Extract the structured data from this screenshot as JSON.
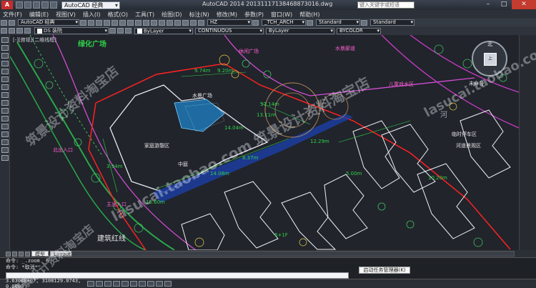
{
  "titlebar": {
    "workspace": "AutoCAD 经典",
    "title": "AutoCAD 2014    20131117138468873016.dwg",
    "search_placeholder": "键入关键字或短语"
  },
  "menus": [
    "文件(F)",
    "编辑(E)",
    "视图(V)",
    "插入(I)",
    "格式(O)",
    "工具(T)",
    "绘图(D)",
    "标注(N)",
    "修改(M)",
    "参数(P)",
    "窗口(W)",
    "帮助(H)"
  ],
  "toolbar1": {
    "workspace_dropdown": "AutoCAD 经典",
    "style1": "HZ",
    "style2": "_TCH_ARCH",
    "style3": "Standard",
    "style4": "Standard"
  },
  "toolbar2": {
    "layer": "DS 装院",
    "color": "ByLayer",
    "linetype": "CONTINUOUS",
    "lineweight": "ByLayer",
    "plotstyle": "BYCOLOR"
  },
  "viewport": {
    "label": "[-][俯视][二维线框]",
    "viewcube_face": "上",
    "viewcube_north": "北",
    "ucs_label": "未命名"
  },
  "drawing_labels": [
    "绿化广场",
    "休闲广场",
    "儿童戏水区",
    "家庭游憩区",
    "水景广场",
    "北出入口",
    "主出入口",
    "建筑红线",
    "临时停车区",
    "河道景观区",
    "中庭",
    "6+1F",
    "河",
    "水景廊道"
  ],
  "dimensions": [
    "9.74m",
    "9.20m",
    "14.04m",
    "37.14m",
    "13.11m",
    "15.60m",
    "14.08m",
    "8.37m",
    "10.20m",
    "12.29m",
    "5.00m",
    "3.94m"
  ],
  "tabs": [
    "模型",
    "Layout1"
  ],
  "commands": [
    "命令: _.zoom _e",
    "命令: *取消*"
  ],
  "tooltip": "启动任务管理器(K)",
  "status": {
    "coords": "3.6308E+07, 3108129.0743, 0.0000"
  },
  "watermarks": [
    "lasucai.taobao.com 筑景设计资料淘宝店",
    "筑景设计资料淘宝店",
    "lasucai.taobao.com",
    "筑景设计资料淘宝店"
  ]
}
